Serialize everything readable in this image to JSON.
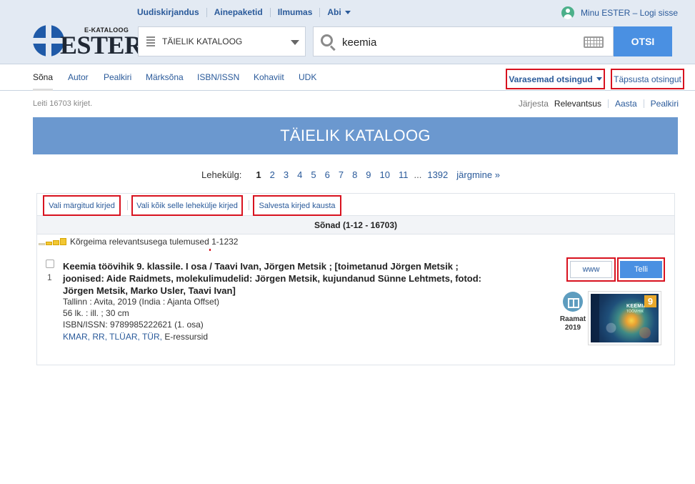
{
  "header": {
    "top_nav": [
      {
        "label": "Uudiskirjandus"
      },
      {
        "label": "Ainepaketid"
      },
      {
        "label": "Ilmumas"
      },
      {
        "label": "Abi"
      }
    ],
    "user_link": "Minu ESTER – Logi sisse",
    "logo_small": "E-KATALOOG",
    "logo_big": "ESTER",
    "catalog_select": "TÄIELIK KATALOOG",
    "search_value": "keemia",
    "search_button": "OTSI"
  },
  "search_tabs": [
    {
      "label": "Sõna"
    },
    {
      "label": "Autor"
    },
    {
      "label": "Pealkiri"
    },
    {
      "label": "Märksõna"
    },
    {
      "label": "ISBN/ISSN"
    },
    {
      "label": "Kohaviit"
    },
    {
      "label": "UDK"
    }
  ],
  "previous_searches": "Varasemad otsingud",
  "refine_search": "Täpsusta otsingut",
  "found_text": "Leiti 16703 kirjet.",
  "sort": {
    "label": "Järjesta",
    "options": [
      "Relevantsus",
      "Aasta",
      "Pealkiri"
    ]
  },
  "banner_title": "TÄIELIK KATALOOG",
  "pager": {
    "label": "Lehekülg:",
    "pages": [
      "1",
      "2",
      "3",
      "4",
      "5",
      "6",
      "7",
      "8",
      "9",
      "10",
      "11"
    ],
    "ellipsis": "...",
    "last": "1392",
    "next": "järgmine »"
  },
  "toolbar": {
    "select_marked": "Vali märgitud kirjed",
    "select_all_page": "Vali kõik selle lehekülje kirjed",
    "save_to_folder": "Salvesta kirjed kausta"
  },
  "results_header": "Sõnad (1-12 - 16703)",
  "relevance_text": "Kõrgeima relevantsusega tulemused 1-1232",
  "record": {
    "number": "1",
    "title": "Keemia töövihik 9. klassile. I osa / Taavi Ivan, Jörgen Metsik ; [toimetanud Jörgen Metsik ; joonised: Aide Raidmets, molekulimudelid: Jörgen Metsik, kujundanud Sünne Lehtmets, fotod: Jörgen Metsik, Marko Usler, Taavi Ivan]",
    "publication": "Tallinn : Avita, 2019 (India : Ajanta Offset)",
    "physical": "56 lk. : ill. ; 30 cm",
    "isbn": "ISBN/ISSN:  9789985222621 (1. osa)",
    "links": [
      "KMAR,",
      "RR,",
      "TLÜAR,",
      "TÜR,"
    ],
    "eresource": "E-ressursid",
    "www_button": "www",
    "order_button": "Telli",
    "type": "Raamat",
    "year": "2019",
    "cover_title": "KEEMIA",
    "cover_subtitle": "TÖÖVIHIK",
    "cover_number": "9"
  },
  "colors": {
    "accent": "#4a90e2",
    "banner": "#6b98cf",
    "link": "#2a5a9a",
    "highlight": "#d8121f"
  }
}
